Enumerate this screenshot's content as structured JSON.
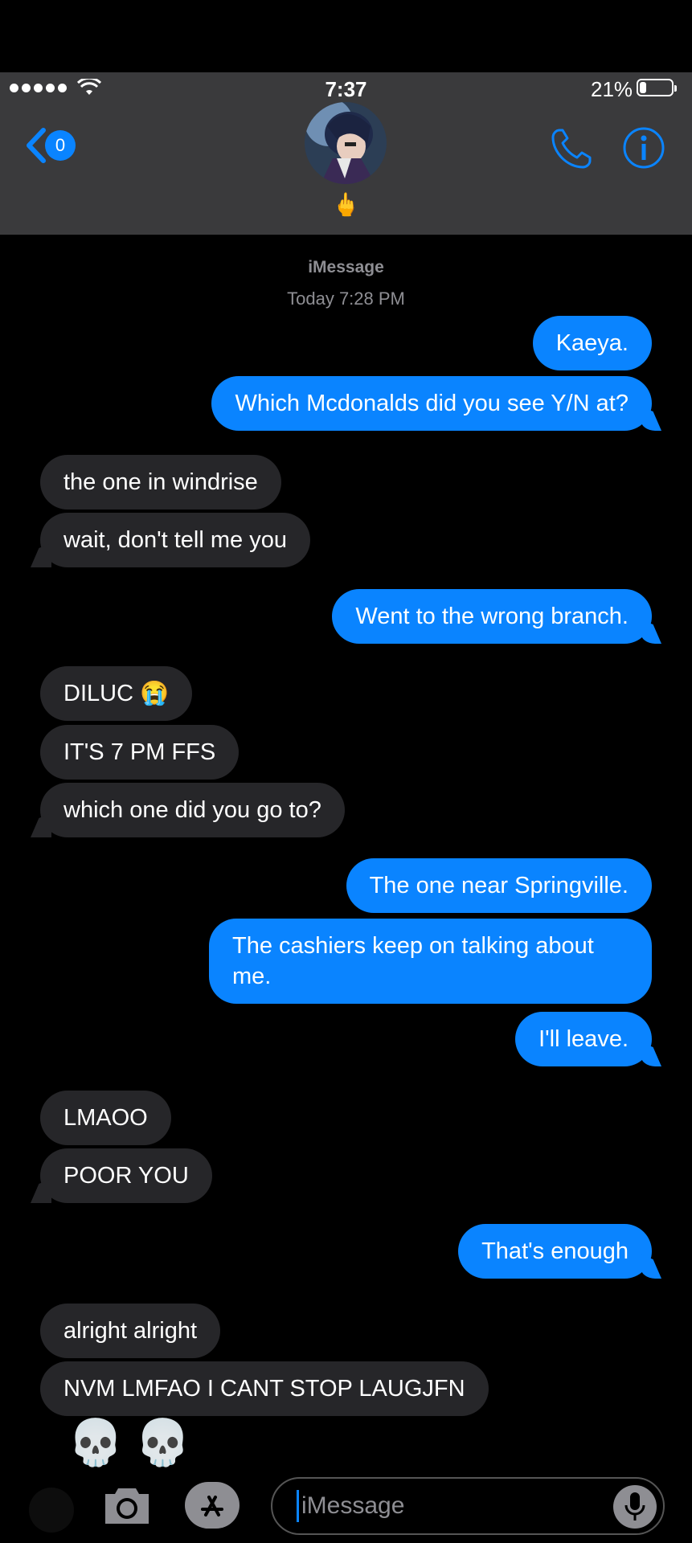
{
  "status_bar": {
    "time": "7:37",
    "battery_text": "21%",
    "battery_level": 0.21
  },
  "header": {
    "back_count": "0",
    "contact_emoji": "🖕",
    "icons": {
      "back": "chevron-left-icon",
      "call": "phone-icon",
      "info": "info-icon"
    },
    "accent_color": "#0a84ff"
  },
  "thread": {
    "service": "iMessage",
    "timestamp": "Today 7:28 PM",
    "messages": [
      {
        "from": "me",
        "text": "Kaeya."
      },
      {
        "from": "me",
        "text": "Which Mcdonalds did you see Y/N at?"
      },
      {
        "from": "them",
        "text": "the one in windrise"
      },
      {
        "from": "them",
        "text": "wait, don't tell me you"
      },
      {
        "from": "me",
        "text": "Went to the wrong branch."
      },
      {
        "from": "them",
        "text": "DILUC 😭"
      },
      {
        "from": "them",
        "text": "IT'S 7 PM FFS"
      },
      {
        "from": "them",
        "text": "which one did you go to?"
      },
      {
        "from": "me",
        "text": "The one near Springville."
      },
      {
        "from": "me",
        "text": "The cashiers keep on talking about me."
      },
      {
        "from": "me",
        "text": "I'll leave."
      },
      {
        "from": "them",
        "text": "LMAOO"
      },
      {
        "from": "them",
        "text": "POOR YOU"
      },
      {
        "from": "me",
        "text": "That's enough"
      },
      {
        "from": "them",
        "text": "alright alright"
      },
      {
        "from": "them",
        "text": "NVM LMFAO I CANT STOP LAUGJFN"
      },
      {
        "from": "them",
        "text": "💀💀"
      }
    ]
  },
  "input_bar": {
    "placeholder": "iMessage",
    "icons": [
      "camera-icon",
      "app-store-icon",
      "microphone-icon"
    ]
  }
}
